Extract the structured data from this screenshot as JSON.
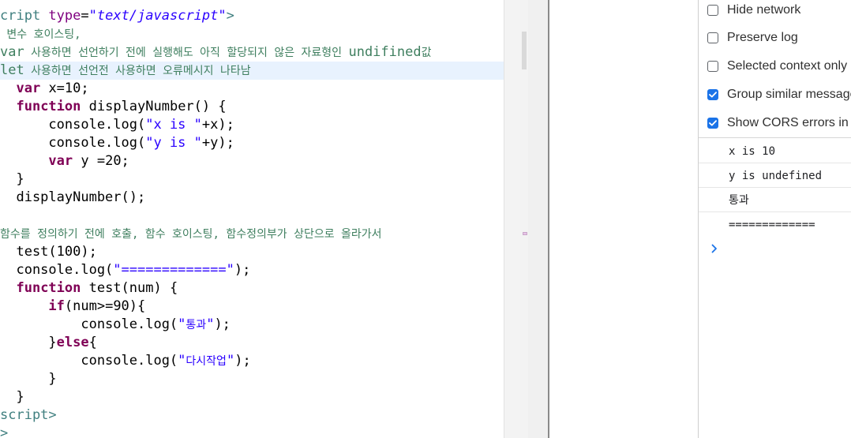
{
  "editor": {
    "lines": [
      [
        {
          "c": "tag",
          "t": "cript "
        },
        {
          "c": "attr",
          "t": "type"
        },
        {
          "c": "plain",
          "t": "="
        },
        {
          "c": "attrval",
          "t": "\"text/javascript\""
        },
        {
          "c": "tag",
          "t": ">"
        }
      ],
      [
        {
          "c": "cm",
          "t": " 변수 호이스팅,"
        }
      ],
      [
        {
          "c": "cm-big",
          "t": "var"
        },
        {
          "c": "cm",
          "t": " 사용하면 선언하기 전에 실행해도 아직 할당되지 않은 자료형인 "
        },
        {
          "c": "cm-big",
          "t": "undifined"
        },
        {
          "c": "cm",
          "t": "값"
        }
      ],
      [
        {
          "c": "cm-big",
          "t": "let"
        },
        {
          "c": "cm",
          "t": " 사용하면 선언전 사용하면 오류메시지 나타남"
        }
      ],
      [
        {
          "c": "plain",
          "t": "  "
        },
        {
          "c": "kw",
          "t": "var"
        },
        {
          "c": "plain",
          "t": " x=10;"
        }
      ],
      [
        {
          "c": "plain",
          "t": "  "
        },
        {
          "c": "kw",
          "t": "function"
        },
        {
          "c": "plain",
          "t": " displayNumber() {"
        }
      ],
      [
        {
          "c": "plain",
          "t": "      console.log("
        },
        {
          "c": "str",
          "t": "\"x is \""
        },
        {
          "c": "plain",
          "t": "+x);"
        }
      ],
      [
        {
          "c": "plain",
          "t": "      console.log("
        },
        {
          "c": "str",
          "t": "\"y is \""
        },
        {
          "c": "plain",
          "t": "+y);"
        }
      ],
      [
        {
          "c": "plain",
          "t": "      "
        },
        {
          "c": "kw",
          "t": "var"
        },
        {
          "c": "plain",
          "t": " y =20;"
        }
      ],
      [
        {
          "c": "plain",
          "t": "  }"
        }
      ],
      [
        {
          "c": "plain",
          "t": "  displayNumber();"
        }
      ],
      [],
      [
        {
          "c": "cm",
          "t": "함수를 정의하기 전에 호출, 함수 호이스팅, 함수정의부가 상단으로 올라가서"
        }
      ],
      [
        {
          "c": "plain",
          "t": "  test(100);"
        }
      ],
      [
        {
          "c": "plain",
          "t": "  console.log("
        },
        {
          "c": "str",
          "t": "\"=============\""
        },
        {
          "c": "plain",
          "t": ");"
        }
      ],
      [
        {
          "c": "plain",
          "t": "  "
        },
        {
          "c": "kw",
          "t": "function"
        },
        {
          "c": "plain",
          "t": " test(num) {"
        }
      ],
      [
        {
          "c": "plain",
          "t": "      "
        },
        {
          "c": "kw",
          "t": "if"
        },
        {
          "c": "plain",
          "t": "(num>=90){"
        }
      ],
      [
        {
          "c": "plain",
          "t": "          console.log("
        },
        {
          "c": "str",
          "t": "\""
        },
        {
          "c": "str kr",
          "t": "통과"
        },
        {
          "c": "str",
          "t": "\""
        },
        {
          "c": "plain",
          "t": ");"
        }
      ],
      [
        {
          "c": "plain",
          "t": "      }"
        },
        {
          "c": "kw",
          "t": "else"
        },
        {
          "c": "plain",
          "t": "{"
        }
      ],
      [
        {
          "c": "plain",
          "t": "          console.log("
        },
        {
          "c": "str",
          "t": "\""
        },
        {
          "c": "str kr",
          "t": "다시작업"
        },
        {
          "c": "str",
          "t": "\""
        },
        {
          "c": "plain",
          "t": ");"
        }
      ],
      [
        {
          "c": "plain",
          "t": "      }"
        }
      ],
      [
        {
          "c": "plain",
          "t": "  }"
        }
      ],
      [
        {
          "c": "tag",
          "t": "script>"
        }
      ],
      [
        {
          "c": "tag",
          "t": ">"
        }
      ]
    ],
    "highlighted_line": 3
  },
  "console": {
    "options": [
      {
        "label": "Hide network",
        "checked": false
      },
      {
        "label": "Preserve log",
        "checked": false
      },
      {
        "label": "Selected context only",
        "checked": false
      },
      {
        "label": "Group similar messages in console",
        "checked": true
      },
      {
        "label": "Show CORS errors in console",
        "checked": true
      }
    ],
    "messages": [
      "x is 10",
      "y is undefined",
      "통과",
      "============="
    ],
    "prompt_symbol": "›",
    "check_color": "#1a73e8"
  }
}
